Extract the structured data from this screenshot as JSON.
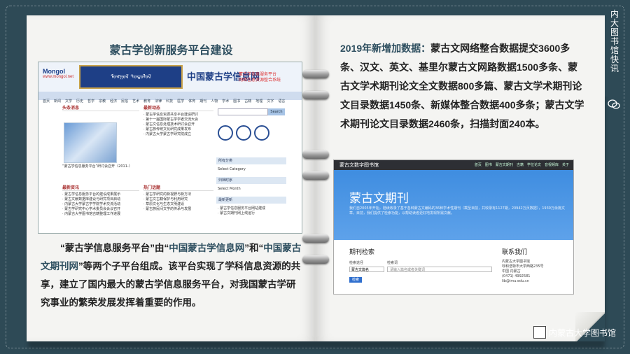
{
  "left_page": {
    "title": "蒙古学创新服务平台建设",
    "paragraph": {
      "q1": "“",
      "t1": "蒙古学信息服务平台",
      "q2": "”由“",
      "t2": "中国蒙古学信息网",
      "q3": "”和“",
      "t3": "中国蒙古文期刊网",
      "q4": "”",
      "rest": "等两个子平台组成。该平台实现了学科信息资源的共享，建立了国内最大的蒙古学信息服务平台，对我国蒙古学研究事业的繁荣发展发挥着重要的作用。"
    },
    "screenshot1": {
      "logo": "Mongol",
      "logo_sub": "www.mongol.net",
      "mongol_script": "ᠮᠣᠩᠭᠣᠯ ᠰᠤᠳᠤᠯᠤᠯ",
      "chinese_title": "中国蒙古学信息网",
      "subtitle_1": "蒙古学信息服务平台",
      "subtitle_2": "网络信息资源整合系统",
      "nav": [
        "首页",
        "新闻",
        "文学",
        "历史",
        "哲学",
        "宗教",
        "经济",
        "民俗",
        "艺术",
        "教育",
        "法律",
        "科技",
        "医学",
        "体育",
        "期刊",
        "人物",
        "学术",
        "图书",
        "古籍",
        "地理",
        "文字",
        "语言"
      ],
      "col1_head": "头条消息",
      "col1_caption": "“蒙古学信息服务平台”研讨会召开（2011-）",
      "col1_head2": "最新资讯",
      "col1_items": [
        "蒙古学信息服务平台的建设成果展示",
        "蒙古文献数据库建设与研究项目启动",
        "内蒙古大学蒙古学学院学术交流活动",
        "蒙古学研究中心学术委员会会议召开",
        "内蒙古大学图书馆古籍整理工作进展"
      ],
      "col2_head": "最新动态",
      "col2_items": [
        "蒙古学信息资源共享平台建设研讨",
        "第十一届国际蒙古学学者交流大会",
        "蒙古文信息处理技术研讨会召开",
        "蒙古族传统文化研究成果发布",
        "内蒙古大学蒙古学研究院成立"
      ],
      "col2_head2": "热门话题",
      "col2_items2": [
        "蒙古学研究的新视野与新方法",
        "蒙古文古籍保护与利用研究",
        "草原文化与生态文明建设",
        "蒙古族民间文学的传承与发展"
      ],
      "search_btn": "Search",
      "panel_1": "所有分类",
      "panel_1_sel": "Select Category",
      "panel_2": "归档时序",
      "panel_2_sel": "Select Month",
      "panel_3": "最新更新",
      "panel_3_items": [
        "蒙古学信息服务平台网站建成",
        "蒙古文期刊网上线运行"
      ]
    }
  },
  "right_page": {
    "intro_label": "2019年新增加数据：",
    "intro_text": "蒙古文网络整合数据提交3600多条、汉文、英文、基里尔蒙古文网路数据1500多条、蒙古文学术期刊论文全文数据800多篇、蒙古文学术期刊论文目录数据1450条、新媒体整合数据400多条；蒙古文学术期刊论文目录数据2460条，扫描封面240本。",
    "screenshot2": {
      "brand": "蒙古文数字图书馆",
      "menu": [
        "首页",
        "图书",
        "蒙古文期刊",
        "古籍",
        "学位论文",
        "音视频库",
        "关于"
      ],
      "hero_title": "蒙古文期刊",
      "hero_desc": "我们自2005年开始，陆续收录了基于各种蒙古文编码的36种学术性期刊（截至目前，共收录有1127期，20942万页数据），1939万余篇文章，目前，我们提供了检索功能，以帮助读者更好地发现所需文献。",
      "search_title": "期刊检索",
      "search_label": "检索途径",
      "search_key_label": "检索词",
      "select_value": "蒙古文篇名",
      "input_placeholder": "请输入篇名或者关键词",
      "search_button": "检索",
      "contact_title": "联系我们",
      "contact_lines": [
        "内蒙古大学图书馆",
        "呼和浩特市大学西路235号",
        "中国 内蒙古",
        "(0471) 4992581",
        "lib@imu.edu.cn"
      ]
    }
  },
  "side_tab_text": "内大图书馆快讯",
  "footer_text": "内蒙古大学图书馆",
  "colors": {
    "board": "#2e4a56",
    "title": "#2d4e5f",
    "hero": "#3f8de0"
  }
}
